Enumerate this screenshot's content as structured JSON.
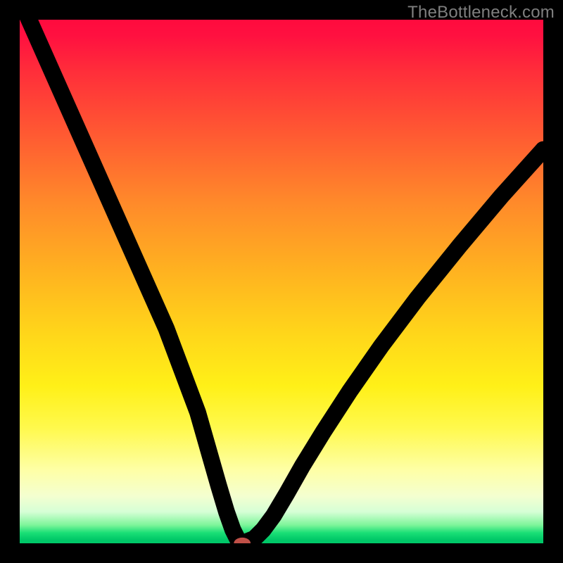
{
  "watermark": "TheBottleneck.com",
  "chart_data": {
    "type": "line",
    "title": "",
    "xlabel": "",
    "ylabel": "",
    "xlim": [
      0,
      100
    ],
    "ylim": [
      0,
      100
    ],
    "grid": false,
    "legend": false,
    "background_gradient": {
      "direction": "top-to-bottom",
      "stops": [
        {
          "pos": 0.0,
          "color": "#ff0b3e"
        },
        {
          "pos": 0.5,
          "color": "#ffd61a"
        },
        {
          "pos": 0.92,
          "color": "#feffa6"
        },
        {
          "pos": 1.0,
          "color": "#00c868"
        }
      ]
    },
    "series": [
      {
        "name": "bottleneck-curve",
        "x": [
          0,
          4,
          8,
          12,
          16,
          20,
          24,
          28,
          31,
          34,
          36,
          38,
          39.5,
          40.7,
          41.6,
          42.2,
          42.8,
          44.8,
          46.5,
          48.5,
          51,
          54,
          58,
          63,
          69,
          76,
          84,
          92,
          100
        ],
        "y": [
          104,
          95,
          86,
          77,
          68,
          59,
          50,
          41,
          33,
          25,
          18,
          11,
          6.0,
          2.6,
          0.8,
          0.1,
          0.1,
          0.9,
          2.6,
          5.3,
          9.5,
          14.8,
          21.3,
          29.0,
          37.6,
          46.9,
          56.8,
          66.3,
          75.2
        ]
      }
    ],
    "marker": {
      "name": "optimum-point",
      "x": 42.5,
      "y": 0.0,
      "rx": 1.6,
      "ry": 1.1,
      "color": "#c05048"
    }
  }
}
